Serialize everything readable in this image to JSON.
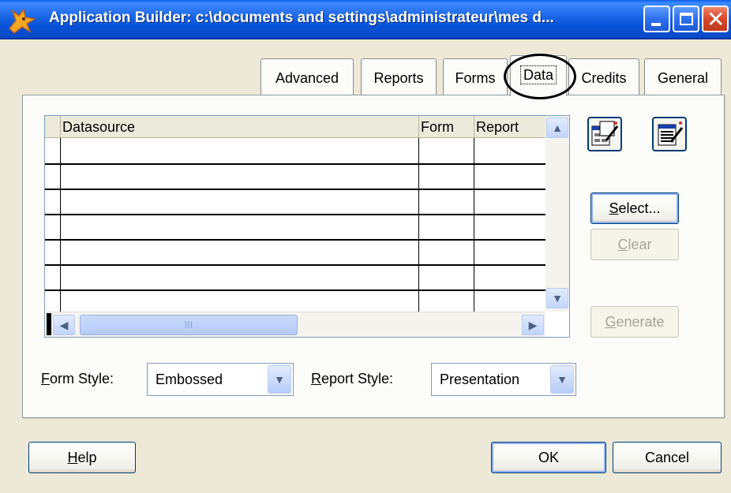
{
  "window": {
    "title": "Application Builder: c:\\documents and settings\\administrateur\\mes d...",
    "min_label": "",
    "colors": {
      "titlebar": "#0a5fe8",
      "face": "#ece9d8"
    }
  },
  "tabs": [
    {
      "label": "Advanced"
    },
    {
      "label": "Reports"
    },
    {
      "label": "Forms"
    },
    {
      "label": "Data"
    },
    {
      "label": "Credits"
    },
    {
      "label": "General"
    }
  ],
  "grid": {
    "columns": [
      "Datasource",
      "Form",
      "Report"
    ],
    "rows": [
      [
        "",
        "",
        ""
      ],
      [
        "",
        "",
        ""
      ],
      [
        "",
        "",
        ""
      ],
      [
        "",
        "",
        ""
      ],
      [
        "",
        "",
        ""
      ],
      [
        "",
        "",
        ""
      ],
      [
        "",
        "",
        ""
      ]
    ],
    "thumb_grip": "III"
  },
  "buttons": {
    "select": "elect...",
    "select_key": "S",
    "clear": "lear",
    "clear_key": "C",
    "generate": "enerate",
    "generate_key": "G",
    "help": "elp",
    "help_key": "H",
    "ok": "OK",
    "cancel": "Cancel"
  },
  "form_style": {
    "label_key": "F",
    "label": "orm Style:",
    "value": "Embossed"
  },
  "report_style": {
    "label_key": "R",
    "label": "eport Style:",
    "value": "Presentation"
  },
  "icons": [
    "fox-app-icon",
    "form-wizard-icon",
    "report-wizard-icon",
    "minimize-icon",
    "maximize-icon",
    "close-icon"
  ]
}
